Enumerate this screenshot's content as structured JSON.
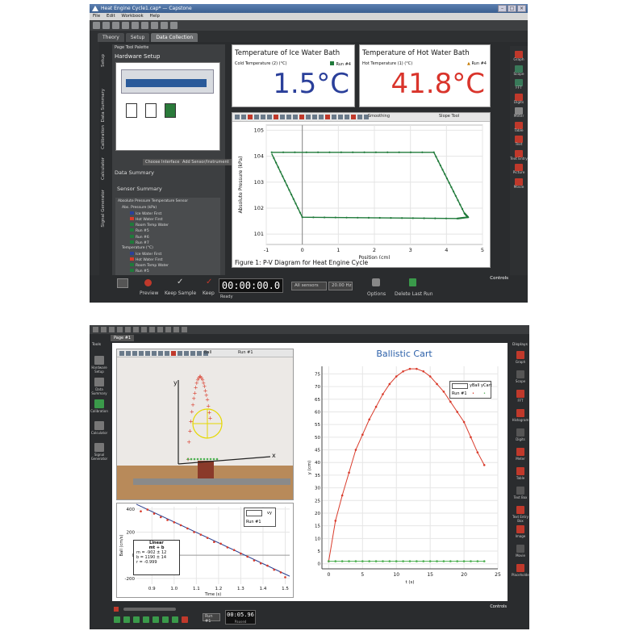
{
  "top": {
    "title": "Heat Engine Cycle1.cap* — Capstone",
    "menu": [
      "File",
      "Edit",
      "Workbook",
      "Help"
    ],
    "tabs": [
      "Theory",
      "Setup",
      "Data Collection"
    ],
    "palette_title": "Page Tool Palette",
    "hardware_title": "Hardware Setup",
    "vtabs": [
      "Setup",
      "Data Summary",
      "Calibration",
      "Calculator",
      "Signal Generator"
    ],
    "choose_interface": "Choose Interface",
    "add_sensor": "Add Sensor/Instrument",
    "data_summary": "Data Summary",
    "sensor_summary": "Sensor Summary",
    "sensor_name": "Absolute Pressure Temperature Sensor",
    "tree": [
      "Abs. Pressure (kPa)",
      "Ice Water First",
      "Hot Water First",
      "Room Temp Water",
      "Run #5",
      "Run #6",
      "Run #7",
      "Temperature (°C)",
      "Ice Water First",
      "Hot Water First",
      "Room Temp Water",
      "Run #5"
    ],
    "digits_left": {
      "title": "Temperature of Ice Water Bath",
      "label": "Cold Temperature (2) (°C)",
      "run": "Run #4",
      "value": "1.5°C"
    },
    "digits_right": {
      "title": "Temperature of Hot Water Bath",
      "label": "Hot Temperature (1) (°C)",
      "run": "Run #4",
      "value": "41.8°C"
    },
    "graph_toolbar": {
      "smoothing": "Smoothing",
      "slope_tool": "Slope Tool"
    },
    "caption": "Figure 1: P-V Diagram for Heat Engine Cycle",
    "right_icons": [
      "Graph",
      "Scope",
      "FFT",
      "Digits",
      "Meter",
      "Table",
      "Text",
      "Text Entry",
      "Picture",
      "Movie"
    ],
    "controls_label": "Controls",
    "bottom": {
      "preview": "Preview",
      "keep_sample": "Keep Sample",
      "keep": "Keep",
      "time": "00:00:00.0",
      "ready": "Ready",
      "all_sensors": "All sensors",
      "rate": "20.00 Hz",
      "options": "Options",
      "delete": "Delete Last Run"
    },
    "chart_data": {
      "type": "line",
      "xlabel": "Position (cm)",
      "ylabel": "Absolute Pressure (kPa)",
      "xlim": [
        -1,
        5
      ],
      "ylim": [
        100.6,
        105.2
      ],
      "xticks": [
        -1,
        0,
        1,
        2,
        3,
        4,
        5
      ],
      "yticks": [
        101,
        102,
        103,
        104,
        105
      ],
      "grid": true,
      "series": [
        {
          "color": "#1f7a3a",
          "points": [
            [
              -0.85,
              104.15
            ],
            [
              3.65,
              104.15
            ],
            [
              4.5,
              101.8
            ],
            [
              4.6,
              101.65
            ],
            [
              4.3,
              101.6
            ],
            [
              0.0,
              101.65
            ],
            [
              -0.85,
              104.1
            ]
          ]
        }
      ]
    }
  },
  "bottom_app": {
    "page_tab": "Page #1",
    "tools_label": "Tools",
    "displays_label": "Displays",
    "left_tools": [
      "Hardware Setup",
      "Data Summary",
      "Calibration",
      "Calculator",
      "Signal Generator"
    ],
    "right_icons": [
      "Graph",
      "Scope",
      "FFT",
      "Histogram",
      "Digits",
      "Meter",
      "Table",
      "Text Box",
      "Text Entry Box",
      "Image",
      "Movie",
      "Placeholder"
    ],
    "video_toolbar": {
      "ball": "Ball",
      "run": "Run #1"
    },
    "video_labels": {
      "x": "x",
      "y": "y"
    },
    "cart_title": "Ballistic Cart",
    "legend": {
      "col1": "yBall",
      "col2": "yCart",
      "run": "Run #1"
    },
    "small_legend": {
      "col": "vy",
      "run": "Run #1"
    },
    "linear_box": {
      "title": "Linear",
      "formula": "mt + b",
      "m": "m = -902 ± 12",
      "b": "b = 1190 ± 14",
      "r": "r = -0.999"
    },
    "controls_label": "Controls",
    "time": "00:05.96",
    "time_state": "Paused",
    "run_select": "Run #1",
    "chart_data": [
      {
        "type": "scatter",
        "title": "Ballistic Cart",
        "xlabel": "t (s)",
        "ylabel": "y (cm)",
        "xlim": [
          -1,
          25
        ],
        "ylim": [
          -2,
          78
        ],
        "xticks": [
          0,
          5,
          10,
          15,
          20,
          25
        ],
        "yticks": [
          0,
          5,
          10,
          15,
          20,
          25,
          30,
          35,
          40,
          45,
          50,
          55,
          60,
          65,
          70,
          75
        ],
        "grid": true,
        "series": [
          {
            "name": "yBall",
            "color": "#d93b2b",
            "x": [
              0,
              1,
              2,
              3,
              4,
              5,
              6,
              7,
              8,
              9,
              10,
              11,
              12,
              13,
              14,
              15,
              16,
              17,
              18,
              19,
              20,
              21,
              22,
              23
            ],
            "y": [
              1,
              17,
              27,
              36,
              45,
              51,
              57,
              62,
              67,
              71,
              74,
              76,
              77,
              77,
              76,
              74,
              71,
              68,
              64,
              60,
              56,
              50,
              44,
              39
            ]
          },
          {
            "name": "yCart",
            "color": "#4caf50",
            "x": [
              0,
              1,
              2,
              3,
              4,
              5,
              6,
              7,
              8,
              9,
              10,
              11,
              12,
              13,
              14,
              15,
              16,
              17,
              18,
              19,
              20,
              21,
              22,
              23
            ],
            "y": [
              1,
              1,
              1,
              1,
              1,
              1,
              1,
              1,
              1,
              1,
              1,
              1,
              1,
              1,
              1,
              1,
              1,
              1,
              1,
              1,
              1,
              1,
              1,
              1
            ]
          }
        ]
      },
      {
        "type": "scatter",
        "xlabel": "Time (s)",
        "ylabel": "Ball (cm/s)",
        "xlim": [
          0.83,
          1.52
        ],
        "ylim": [
          -250,
          420
        ],
        "xticks": [
          0.9,
          1.0,
          1.1,
          1.2,
          1.3,
          1.4,
          1.5
        ],
        "yticks": [
          -200,
          0,
          200,
          400
        ],
        "grid": true,
        "series": [
          {
            "name": "vy",
            "color": "#2a3f8f",
            "x": [
              0.85,
              0.88,
              0.91,
              0.94,
              0.97,
              1.0,
              1.03,
              1.06,
              1.09,
              1.12,
              1.15,
              1.18,
              1.21,
              1.24,
              1.27,
              1.3,
              1.33,
              1.36,
              1.39,
              1.42,
              1.45,
              1.48,
              1.5
            ],
            "y": [
              380,
              395,
              360,
              330,
              305,
              285,
              260,
              232,
              200,
              178,
              150,
              115,
              100,
              68,
              45,
              15,
              -12,
              -45,
              -70,
              -90,
              -125,
              -148,
              -190
            ]
          }
        ],
        "fit": {
          "m": -902,
          "b": 1190
        }
      }
    ]
  }
}
